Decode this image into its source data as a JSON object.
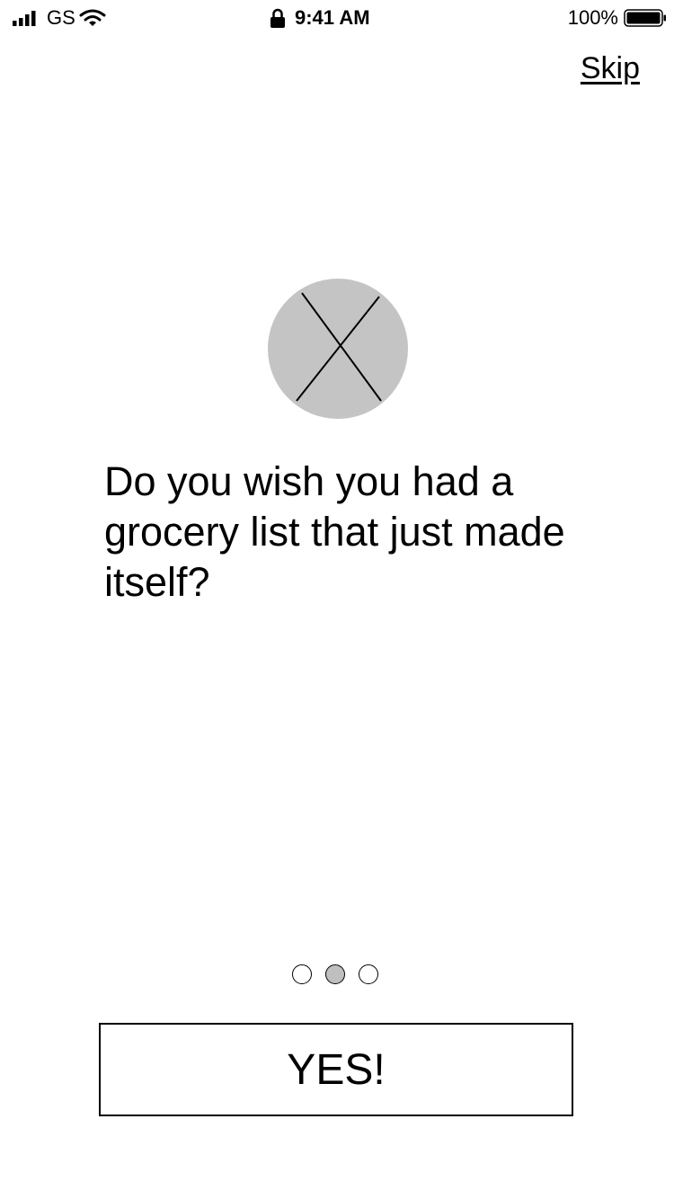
{
  "status_bar": {
    "carrier": "GS",
    "time": "9:41 AM",
    "battery": "100%",
    "icons": [
      "signal-bars-icon",
      "wifi-icon",
      "lock-icon",
      "battery-icon"
    ]
  },
  "header": {
    "skip_label": "Skip"
  },
  "hero": {
    "icon": "image-placeholder-icon",
    "fill_color": "#c4c4c4"
  },
  "main": {
    "question": "Do you wish you had a grocery list that just made itself?"
  },
  "pager": {
    "page_count": 3,
    "current_page": 2
  },
  "actions": {
    "yes_label": "YES!"
  }
}
